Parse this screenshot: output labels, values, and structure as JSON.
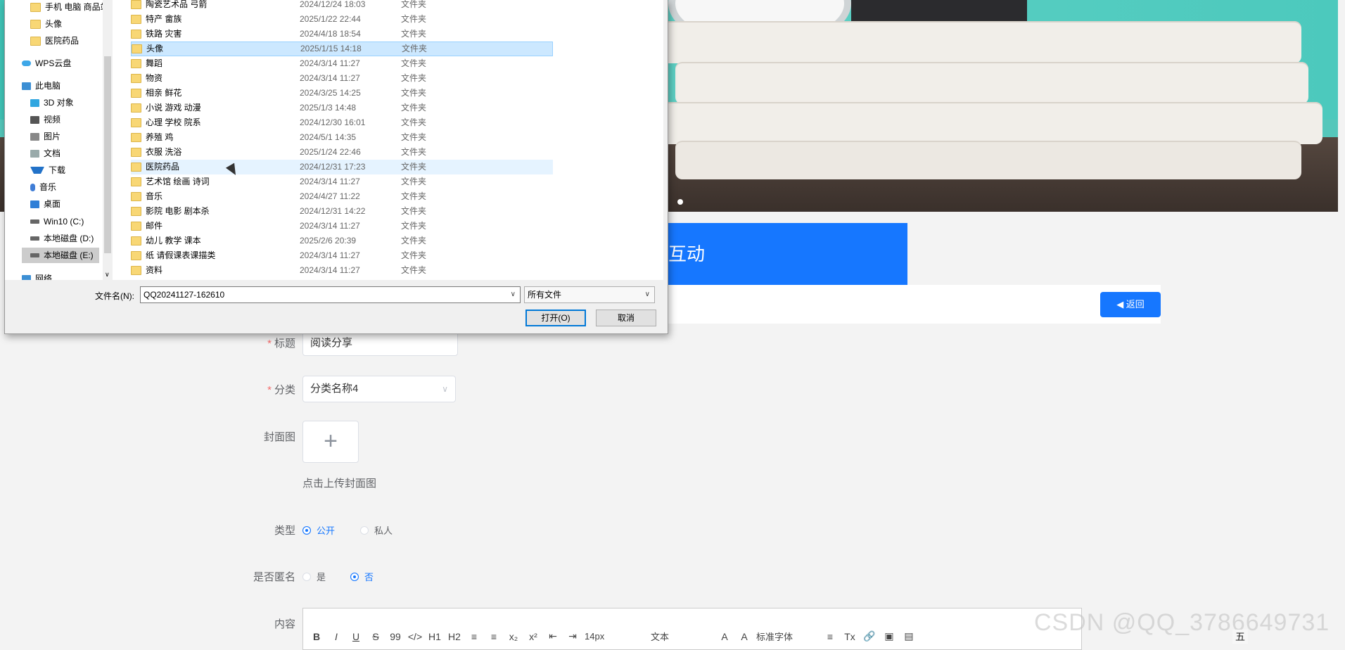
{
  "page": {
    "section_title": "互动",
    "back_button": "◀ 返回",
    "form": {
      "title_label": "标题",
      "title_value": "阅读分享",
      "category_label": "分类",
      "category_value": "分类名称4",
      "cover_label": "封面图",
      "cover_plus": "+",
      "cover_hint": "点击上传封面图",
      "type_label": "类型",
      "type_options": [
        "公开",
        "私人"
      ],
      "type_selected": "公开",
      "anonymous_label": "是否匿名",
      "anonymous_options": [
        "是",
        "否"
      ],
      "anonymous_selected": "否",
      "content_label": "内容",
      "toolbar": [
        "B",
        "I",
        "U",
        "S",
        "99",
        "</>",
        "H1",
        "H2",
        "≡",
        "≡",
        "x₂",
        "x²",
        "⇤",
        "⇥",
        "14px",
        "文本",
        "A",
        "A",
        "标准字体",
        "≡",
        "Tx",
        "🔗",
        "▣",
        "▤"
      ]
    },
    "watermark": "CSDN @QQ_3786649731",
    "tray_text": "五"
  },
  "dialog": {
    "nav": [
      {
        "label": "手机 电脑 商品站",
        "icon": "folder-icon"
      },
      {
        "label": "头像",
        "icon": "folder-icon"
      },
      {
        "label": "医院药品",
        "icon": "folder-icon"
      },
      {
        "label": "WPS云盘",
        "icon": "cloud-icon"
      },
      {
        "label": "此电脑",
        "icon": "computer-icon"
      },
      {
        "label": "3D 对象",
        "icon": "cube-icon"
      },
      {
        "label": "视频",
        "icon": "video-icon"
      },
      {
        "label": "图片",
        "icon": "picture-icon"
      },
      {
        "label": "文档",
        "icon": "document-icon"
      },
      {
        "label": "下载",
        "icon": "download-icon"
      },
      {
        "label": "音乐",
        "icon": "music-icon"
      },
      {
        "label": "桌面",
        "icon": "desktop-icon"
      },
      {
        "label": "Win10 (C:)",
        "icon": "drive-icon"
      },
      {
        "label": "本地磁盘 (D:)",
        "icon": "drive-icon"
      },
      {
        "label": "本地磁盘 (E:)",
        "icon": "drive-icon"
      },
      {
        "label": "网络",
        "icon": "network-icon"
      }
    ],
    "files": [
      {
        "name": "陶瓷艺术品 弓箭",
        "date": "2024/12/24 18:03",
        "type": "文件夹"
      },
      {
        "name": "特产 畲族",
        "date": "2025/1/22 22:44",
        "type": "文件夹"
      },
      {
        "name": "铁路 灾害",
        "date": "2024/4/18 18:54",
        "type": "文件夹"
      },
      {
        "name": "头像",
        "date": "2025/1/15 14:18",
        "type": "文件夹"
      },
      {
        "name": "舞蹈",
        "date": "2024/3/14 11:27",
        "type": "文件夹"
      },
      {
        "name": "物资",
        "date": "2024/3/14 11:27",
        "type": "文件夹"
      },
      {
        "name": "相亲 鲜花",
        "date": "2024/3/25 14:25",
        "type": "文件夹"
      },
      {
        "name": "小说 游戏 动漫",
        "date": "2025/1/3 14:48",
        "type": "文件夹"
      },
      {
        "name": "心理 学校 院系",
        "date": "2024/12/30 16:01",
        "type": "文件夹"
      },
      {
        "name": "养殖 鸡",
        "date": "2024/5/1 14:35",
        "type": "文件夹"
      },
      {
        "name": "衣服 洗浴",
        "date": "2025/1/24 22:46",
        "type": "文件夹"
      },
      {
        "name": "医院药品",
        "date": "2024/12/31 17:23",
        "type": "文件夹"
      },
      {
        "name": "艺术馆 绘画 诗词",
        "date": "2024/3/14 11:27",
        "type": "文件夹"
      },
      {
        "name": "音乐",
        "date": "2024/4/27 11:22",
        "type": "文件夹"
      },
      {
        "name": "影院 电影 剧本杀",
        "date": "2024/12/31 14:22",
        "type": "文件夹"
      },
      {
        "name": "邮件",
        "date": "2024/3/14 11:27",
        "type": "文件夹"
      },
      {
        "name": "幼儿 教学 课本",
        "date": "2025/2/6 20:39",
        "type": "文件夹"
      },
      {
        "name": "纸 请假课表课描类",
        "date": "2024/3/14 11:27",
        "type": "文件夹"
      },
      {
        "name": "资料",
        "date": "2024/3/14 11:27",
        "type": "文件夹"
      }
    ],
    "selected_file": "头像",
    "hovered_file": "医院药品",
    "filename_label": "文件名(N):",
    "filename_value": "QQ20241127-162610",
    "filetype_value": "所有文件",
    "open_button": "打开(O)",
    "cancel_button": "取消",
    "dropdown_arrow": "∨",
    "scroll_down": "∨"
  }
}
